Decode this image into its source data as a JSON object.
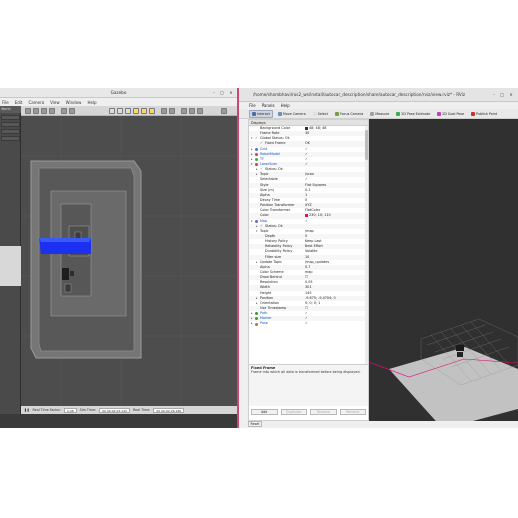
{
  "gazebo": {
    "title": "Gazebo",
    "menu": [
      "File",
      "Edit",
      "Camera",
      "View",
      "Window",
      "Help"
    ],
    "side_tabs": [
      "World",
      "Insert",
      "Layers"
    ],
    "bottom": {
      "real_time_factor_label": "Real Time Factor:",
      "real_time_factor": "0.98",
      "sim_time_label": "Sim Time:",
      "sim_time": "00 00:02:23.120",
      "real_time_label": "Real Time:",
      "real_time": "00 00:02:26.180"
    }
  },
  "rviz": {
    "title": "/home/shambhavi/ros2_ws/install/autocar_description/share/autocar_description/rviz/view.rviz* - RViz",
    "menu": [
      "File",
      "Panels",
      "Help"
    ],
    "toolbar": [
      {
        "label": "Interact",
        "icon": "interact-icon",
        "color": "#4a6fa5",
        "active": true
      },
      {
        "label": "Move Camera",
        "icon": "move-camera-icon",
        "color": "#6a8fb5",
        "active": false
      },
      {
        "label": "Select",
        "icon": "select-icon",
        "color": "#e0e0e0",
        "active": false
      },
      {
        "label": "Focus Camera",
        "icon": "focus-camera-icon",
        "color": "#7a9a4a",
        "active": false
      },
      {
        "label": "Measure",
        "icon": "measure-icon",
        "color": "#a0a0a0",
        "active": false
      },
      {
        "label": "2D Pose Estimate",
        "icon": "pose-estimate-icon",
        "color": "#3ab04a",
        "active": false
      },
      {
        "label": "2D Goal Pose",
        "icon": "goal-pose-icon",
        "color": "#c040c0",
        "active": false
      },
      {
        "label": "Publish Point",
        "icon": "publish-point-icon",
        "color": "#d03030",
        "active": false
      }
    ],
    "displays_header": "Displays",
    "tree": [
      {
        "indent": 1,
        "key": "Background Color",
        "value": "48; 48; 48",
        "swatch": "#303030"
      },
      {
        "indent": 1,
        "key": "Frame Rate",
        "value": "30"
      },
      {
        "indent": 0,
        "arrow": "▾",
        "check": true,
        "key": "Global Status: Ok",
        "value": ""
      },
      {
        "indent": 1,
        "check": true,
        "key": "Fixed Frame",
        "value": "OK"
      },
      {
        "indent": 0,
        "arrow": "▸",
        "icon": "#4a7ac8",
        "key": "Grid",
        "value": "✓",
        "blue": true
      },
      {
        "indent": 0,
        "arrow": "▸",
        "icon": "#c84a4a",
        "key": "RobotModel",
        "value": "✓",
        "blue": true
      },
      {
        "indent": 0,
        "arrow": "▸",
        "icon": "#4aa84a",
        "key": "TF",
        "value": "✓",
        "blue": true
      },
      {
        "indent": 0,
        "arrow": "▾",
        "icon": "#c8484a",
        "key": "LaserScan",
        "value": "✓",
        "blue": true
      },
      {
        "indent": 1,
        "arrow": "▸",
        "check": true,
        "key": "Status: Ok",
        "value": ""
      },
      {
        "indent": 1,
        "arrow": "▸",
        "key": "Topic",
        "value": "/scan"
      },
      {
        "indent": 1,
        "key": "Selectable",
        "value": "✓"
      },
      {
        "indent": 1,
        "key": "Style",
        "value": "Flat Squares"
      },
      {
        "indent": 1,
        "key": "Size (m)",
        "value": "0.1"
      },
      {
        "indent": 1,
        "key": "Alpha",
        "value": "1"
      },
      {
        "indent": 1,
        "key": "Decay Time",
        "value": "0"
      },
      {
        "indent": 1,
        "key": "Position Transformer",
        "value": "XYZ"
      },
      {
        "indent": 1,
        "key": "Color Transformer",
        "value": "FlatColor"
      },
      {
        "indent": 1,
        "key": "Color",
        "value": "230; 10; 110",
        "swatch": "#e60a6e"
      },
      {
        "indent": 0,
        "arrow": "▾",
        "icon": "#6a6ac8",
        "key": "Map",
        "value": "✓",
        "blue": true
      },
      {
        "indent": 1,
        "arrow": "▸",
        "check": true,
        "key": "Status: Ok",
        "value": ""
      },
      {
        "indent": 1,
        "arrow": "▾",
        "key": "Topic",
        "value": "/map"
      },
      {
        "indent": 2,
        "key": "Depth",
        "value": "5"
      },
      {
        "indent": 2,
        "key": "History Policy",
        "value": "Keep Last"
      },
      {
        "indent": 2,
        "key": "Reliability Policy",
        "value": "Best Effort"
      },
      {
        "indent": 2,
        "key": "Durability Policy",
        "value": "Volatile"
      },
      {
        "indent": 2,
        "key": "Filter size",
        "value": "10"
      },
      {
        "indent": 1,
        "arrow": "▸",
        "key": "Update Topic",
        "value": "/map_updates"
      },
      {
        "indent": 1,
        "key": "Alpha",
        "value": "0.7"
      },
      {
        "indent": 1,
        "key": "Color Scheme",
        "value": "map"
      },
      {
        "indent": 1,
        "key": "Draw Behind",
        "value": "☐"
      },
      {
        "indent": 1,
        "key": "Resolution",
        "value": "0.05"
      },
      {
        "indent": 1,
        "key": "Width",
        "value": "301"
      },
      {
        "indent": 1,
        "key": "Height",
        "value": "145"
      },
      {
        "indent": 1,
        "arrow": "▸",
        "key": "Position",
        "value": "-9.675; -9.4704; 0"
      },
      {
        "indent": 1,
        "arrow": "▸",
        "key": "Orientation",
        "value": "0; 0; 0; 1"
      },
      {
        "indent": 1,
        "key": "Use Timestamp",
        "value": "☐"
      },
      {
        "indent": 0,
        "arrow": "▸",
        "icon": "#3a9a3a",
        "key": "Path",
        "value": "✓",
        "blue": true
      },
      {
        "indent": 0,
        "arrow": "▸",
        "icon": "#3a9a3a",
        "key": "Marker",
        "value": "✓",
        "blue": true
      },
      {
        "indent": 0,
        "arrow": "▸",
        "icon": "#d06a2a",
        "key": "Pose",
        "value": "✓",
        "blue": true
      }
    ],
    "description": {
      "heading": "Fixed Frame",
      "text": "Frame into which all data is transformed before being displayed."
    },
    "buttons": [
      {
        "label": "Add",
        "enabled": true
      },
      {
        "label": "Duplicate",
        "enabled": false
      },
      {
        "label": "Remove",
        "enabled": false
      },
      {
        "label": "Rename",
        "enabled": false
      }
    ],
    "reset_label": "Reset"
  }
}
